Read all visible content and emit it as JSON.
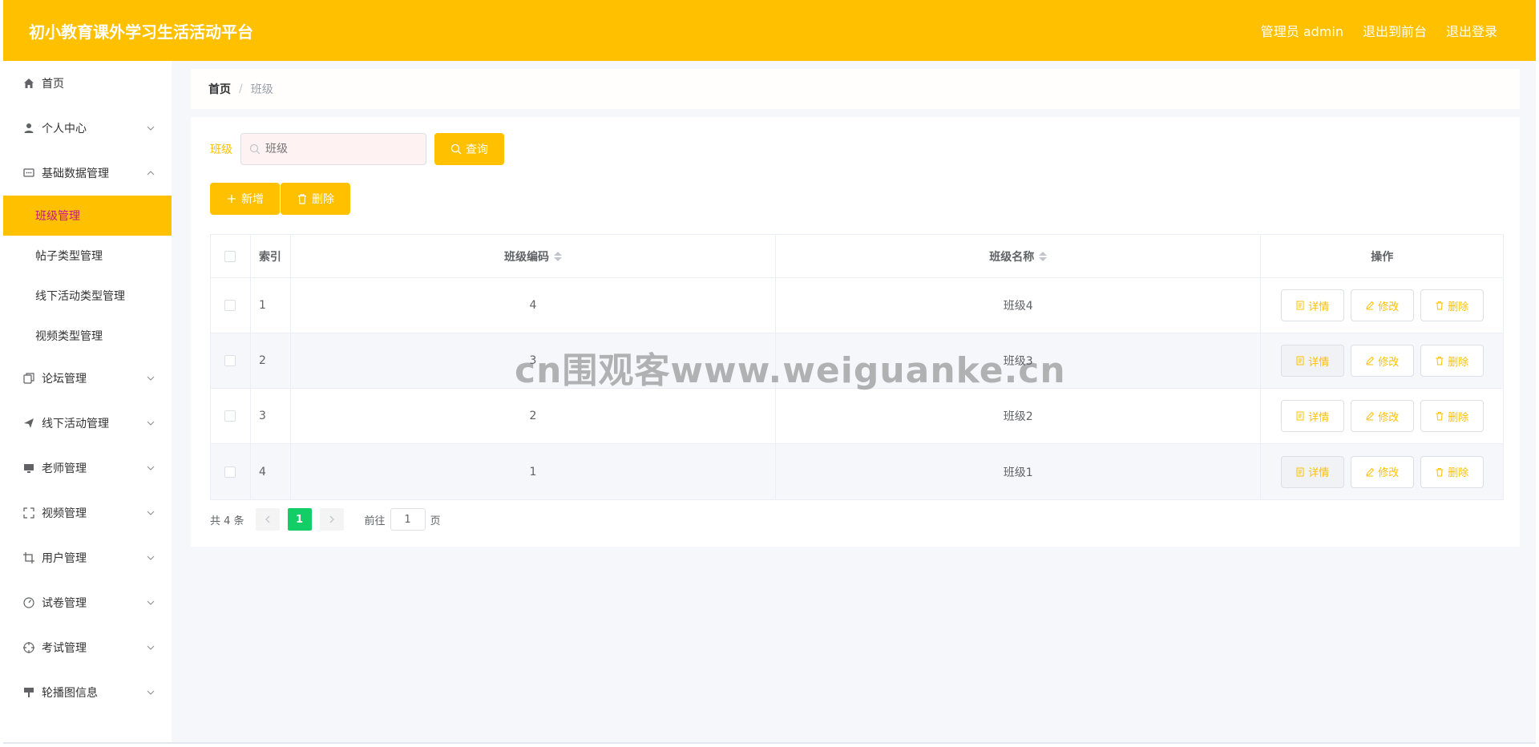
{
  "header": {
    "title": "初小教育课外学习生活活动平台",
    "user_label": "管理员 admin",
    "to_front": "退出到前台",
    "logout": "退出登录"
  },
  "sidebar": {
    "items": [
      {
        "label": "首页",
        "icon": "home-icon"
      },
      {
        "label": "个人中心",
        "icon": "user-icon"
      },
      {
        "label": "基础数据管理",
        "icon": "chat-icon"
      },
      {
        "label": "论坛管理",
        "icon": "copy-icon"
      },
      {
        "label": "线下活动管理",
        "icon": "send-icon"
      },
      {
        "label": "老师管理",
        "icon": "monitor-icon"
      },
      {
        "label": "视频管理",
        "icon": "fullscreen-icon"
      },
      {
        "label": "用户管理",
        "icon": "crop-icon"
      },
      {
        "label": "试卷管理",
        "icon": "gauge-icon"
      },
      {
        "label": "考试管理",
        "icon": "target-icon"
      },
      {
        "label": "轮播图信息",
        "icon": "paint-icon"
      }
    ],
    "submenu": [
      {
        "label": "班级管理",
        "active": true
      },
      {
        "label": "帖子类型管理",
        "active": false
      },
      {
        "label": "线下活动类型管理",
        "active": false
      },
      {
        "label": "视频类型管理",
        "active": false
      }
    ]
  },
  "breadcrumb": {
    "home": "首页",
    "sep": "/",
    "current": "班级"
  },
  "search": {
    "label": "班级",
    "placeholder": "班级",
    "query_label": "查询"
  },
  "actions": {
    "add_label": "新增",
    "delete_label": "删除"
  },
  "table": {
    "headers": {
      "index": "索引",
      "code": "班级编码",
      "name": "班级名称",
      "ops": "操作"
    },
    "rows": [
      {
        "index": "1",
        "code": "4",
        "name": "班级4"
      },
      {
        "index": "2",
        "code": "3",
        "name": "班级3"
      },
      {
        "index": "3",
        "code": "2",
        "name": "班级2"
      },
      {
        "index": "4",
        "code": "1",
        "name": "班级1"
      }
    ],
    "op_labels": {
      "detail": "详情",
      "edit": "修改",
      "delete": "删除"
    }
  },
  "pagination": {
    "total": "共 4 条",
    "current": "1",
    "goto_label": "前往",
    "page_label": "页",
    "goto_value": "1"
  },
  "watermark": "cn围观客www.weiguanke.cn",
  "colors": {
    "accent": "#ffc000",
    "page_active": "#13ce66",
    "submenu_active_text": "#c71585"
  }
}
